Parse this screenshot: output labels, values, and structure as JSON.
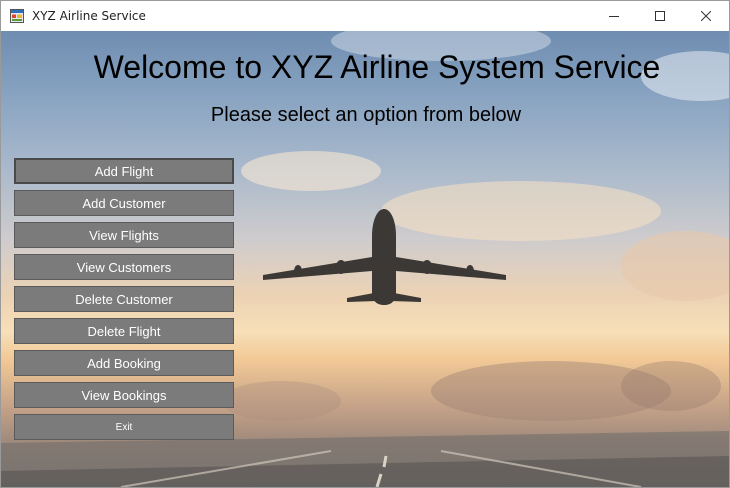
{
  "window": {
    "title": "XYZ Airline Service"
  },
  "main": {
    "heading": "Welcome to XYZ Airline System Service",
    "subheading": "Please select an option from below"
  },
  "menu": {
    "add_flight": "Add Flight",
    "add_customer": "Add Customer",
    "view_flights": "View Flights",
    "view_customers": "View Customers",
    "delete_customer": "Delete Customer",
    "delete_flight": "Delete Flight",
    "add_booking": "Add Booking",
    "view_bookings": "View Bookings",
    "exit": "Exit"
  },
  "colors": {
    "button_background": "#7b7b7b",
    "button_text": "#ffffff",
    "title_text": "#000000"
  },
  "icons": {
    "app": "app-window-icon",
    "minimize": "minimize-icon",
    "maximize": "maximize-icon",
    "close": "close-icon",
    "background": "airplane-photo"
  }
}
